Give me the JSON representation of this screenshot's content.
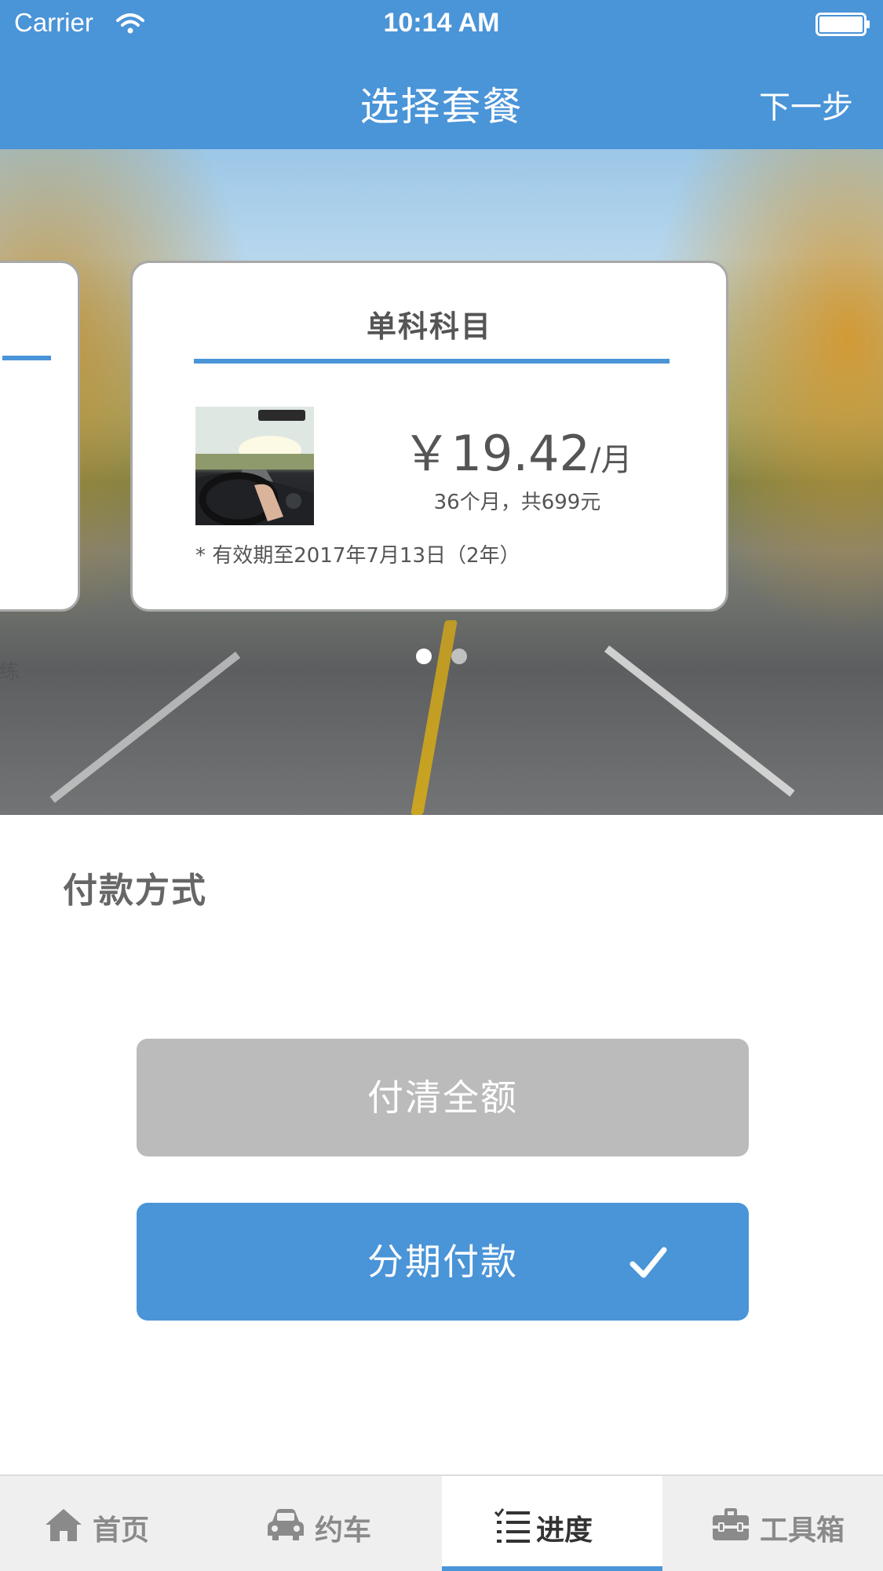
{
  "status_bar": {
    "carrier": "Carrier",
    "time": "10:14 AM"
  },
  "nav": {
    "title": "选择套餐",
    "next_label": "下一步"
  },
  "card": {
    "title": "单科科目",
    "price_value": "￥19.42",
    "price_unit": "/月",
    "price_sub": "36个月，共699元",
    "note": "* 有效期至2017年7月13日（2年）"
  },
  "prev_card": {
    "partial_text": "练"
  },
  "pager": {
    "count": 2,
    "active_index": 0
  },
  "payment": {
    "section_title": "付款方式",
    "full_label": "付清全额",
    "installment_label": "分期付款",
    "selected": "installment"
  },
  "tabbar": {
    "items": [
      {
        "label": "首页",
        "icon": "home-icon"
      },
      {
        "label": "约车",
        "icon": "car-icon"
      },
      {
        "label": "进度",
        "icon": "list-icon"
      },
      {
        "label": "工具箱",
        "icon": "toolbox-icon"
      }
    ],
    "active_index": 2
  },
  "colors": {
    "accent": "#4a94d8",
    "disabled": "#bbbbbb",
    "tabbar_bg": "#efefef"
  }
}
